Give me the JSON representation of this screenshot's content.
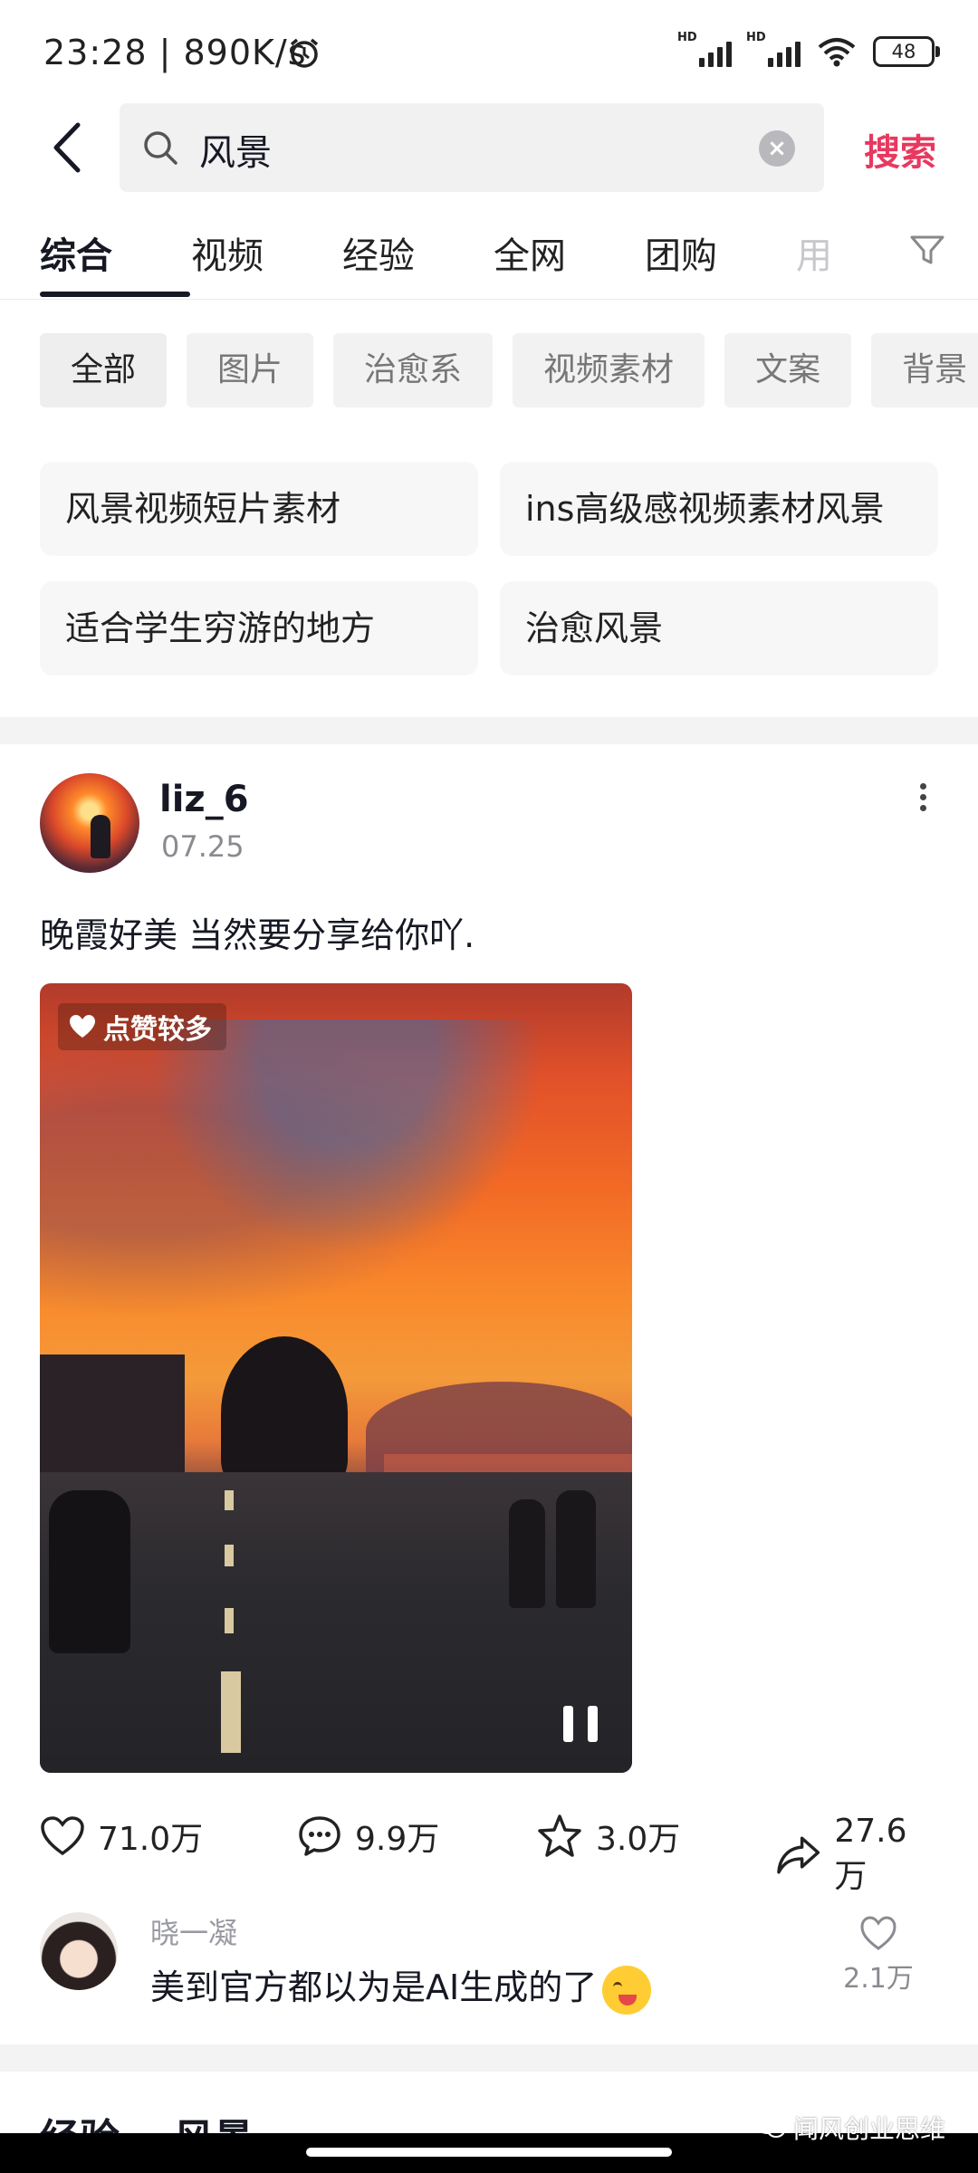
{
  "status_bar": {
    "time_speed": "23:28 | 890K/s",
    "battery": "48",
    "hd1": "HD",
    "hd2": "HD"
  },
  "search": {
    "query": "风景",
    "submit_label": "搜索"
  },
  "tabs": [
    "综合",
    "视频",
    "经验",
    "全网",
    "团购",
    "用"
  ],
  "chips": [
    "全部",
    "图片",
    "治愈系",
    "视频素材",
    "文案",
    "背景"
  ],
  "suggestions": [
    "风景视频短片素材",
    "ins高级感视频素材风景",
    "适合学生穷游的地方",
    "治愈风景"
  ],
  "post": {
    "username": "liz_6",
    "date": "07.25",
    "text": "晚霞好美 当然要分享给你吖.",
    "badge": "点赞较多",
    "likes": "71.0万",
    "comments": "9.9万",
    "favorites": "3.0万",
    "shares": "27.6万"
  },
  "comment": {
    "name": "晓一凝",
    "text": "美到官方都以为是AI生成的了",
    "likes": "2.1万"
  },
  "next_section": {
    "title1": "经验",
    "title2": "风景"
  },
  "watermark": "闻风创业思维",
  "colors": {
    "accent": "#e8385f",
    "text": "#161823",
    "muted": "#8a8b91"
  }
}
